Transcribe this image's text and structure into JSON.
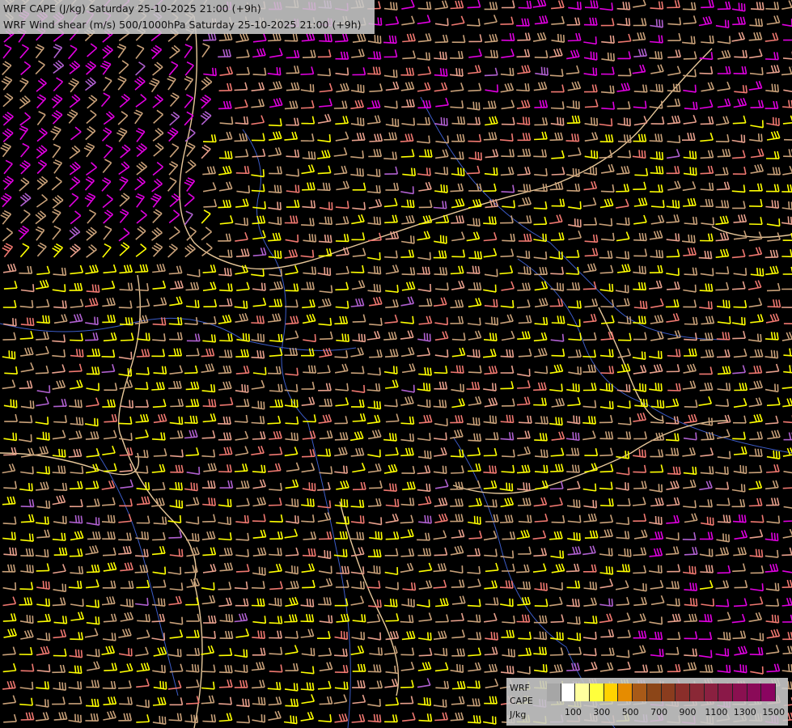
{
  "titles": {
    "line1": "WRF CAPE (J/kg) Saturday 25-10-2025 21:00 (+9h)",
    "line2": "WRF Wind shear (m/s) 500/1000hPa Saturday 25-10-2025 21:00 (+9h)"
  },
  "legend": {
    "label1": "WRF",
    "label2": "CAPE",
    "label3": "J/kg",
    "ticks": [
      "100",
      "300",
      "500",
      "700",
      "900",
      "1100",
      "1300",
      "1500"
    ],
    "colors": [
      "#a6a6a6",
      "#ffffff",
      "#ffff9e",
      "#ffff3c",
      "#ffd200",
      "#e68c00",
      "#a85a18",
      "#8c4618",
      "#8a3c1e",
      "#8a2e2a",
      "#8a2836",
      "#8a2040",
      "#8a1848",
      "#8a1050",
      "#8a0a58",
      "#8a0460"
    ]
  },
  "barb_colors": {
    "tan": "#c8a078",
    "pink": "#e8a08c",
    "salmon": "#f07870",
    "yellow": "#ffff00",
    "magenta": "#e000e0",
    "violet": "#b060d0",
    "dim": "#a07858"
  },
  "map_colors": {
    "border": "#e8c89a",
    "river": "#3c5cc8",
    "background": "#000000"
  }
}
